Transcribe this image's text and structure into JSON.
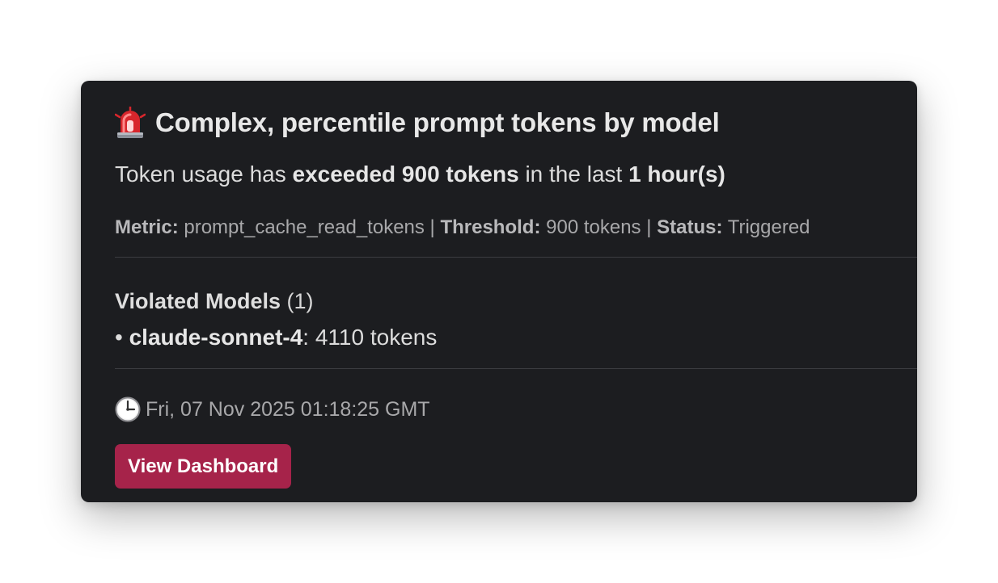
{
  "alert": {
    "icon": "rotating-light-siren-icon",
    "title": "Complex, percentile prompt tokens by model",
    "summary": {
      "prefix": "Token usage has ",
      "exceeded": "exceeded 900 tokens",
      "middle": " in the last ",
      "window": "1 hour(s)"
    },
    "meta": {
      "metric_label": "Metric:",
      "metric_value": " prompt_cache_read_tokens | ",
      "threshold_label": "Threshold:",
      "threshold_value": " 900 tokens | ",
      "status_label": "Status:",
      "status_value": " Triggered"
    },
    "violated": {
      "heading": "Violated Models",
      "count": " (1)",
      "items": [
        {
          "bullet": "• ",
          "model": "claude-sonnet-4",
          "value": ": 4110 tokens"
        }
      ]
    },
    "timestamp_icon": "clock-icon",
    "timestamp": "Fri, 07 Nov 2025 01:18:25 GMT",
    "button_label": "View Dashboard"
  },
  "colors": {
    "card_background": "#1c1d20",
    "button_background": "#a6234a",
    "divider": "#3b3c40"
  }
}
